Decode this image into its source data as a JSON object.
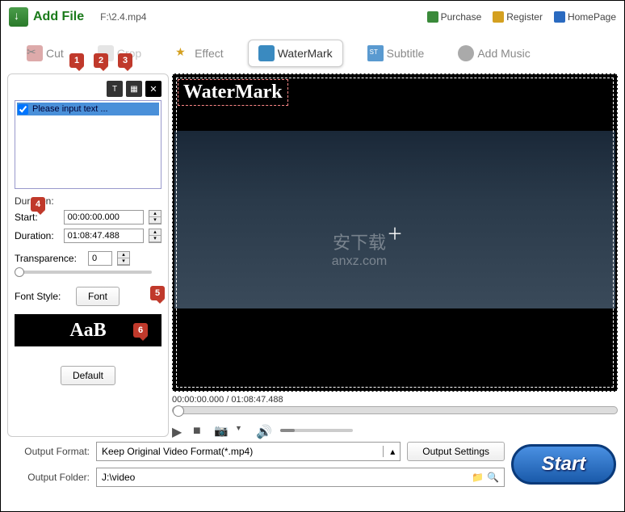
{
  "header": {
    "add_file": "Add File",
    "file_path": "F:\\2.4.mp4",
    "links": {
      "purchase": "Purchase",
      "register": "Register",
      "homepage": "HomePage"
    }
  },
  "tabs": {
    "cut": "Cut",
    "crop": "Crop",
    "effect": "Effect",
    "watermark": "WaterMark",
    "subtitle": "Subtitle",
    "addmusic": "Add Music",
    "active": "watermark"
  },
  "sidebar": {
    "placeholder_item": "Please input text ...",
    "duration_label": "Duration:",
    "start_label": "Start:",
    "start_value": "00:00:00.000",
    "duration2_label": "Duration:",
    "duration_value": "01:08:47.488",
    "transparency_label": "Transparence:",
    "transparency_value": "0",
    "font_style_label": "Font Style:",
    "font_button": "Font",
    "font_preview": "AaB",
    "default_button": "Default"
  },
  "callouts": {
    "c1": "1",
    "c2": "2",
    "c3": "3",
    "c4": "4",
    "c5": "5",
    "c6": "6"
  },
  "preview": {
    "watermark_text": "WaterMark",
    "site_text_cn": "安下载",
    "site_text_url": "anxz.com",
    "time_display": "00:00:00.000 / 01:08:47.488"
  },
  "bottom": {
    "output_format_label": "Output Format:",
    "output_format_value": "Keep Original Video Format(*.mp4)",
    "output_settings": "Output Settings",
    "output_folder_label": "Output Folder:",
    "output_folder_value": "J:\\video",
    "start": "Start"
  }
}
